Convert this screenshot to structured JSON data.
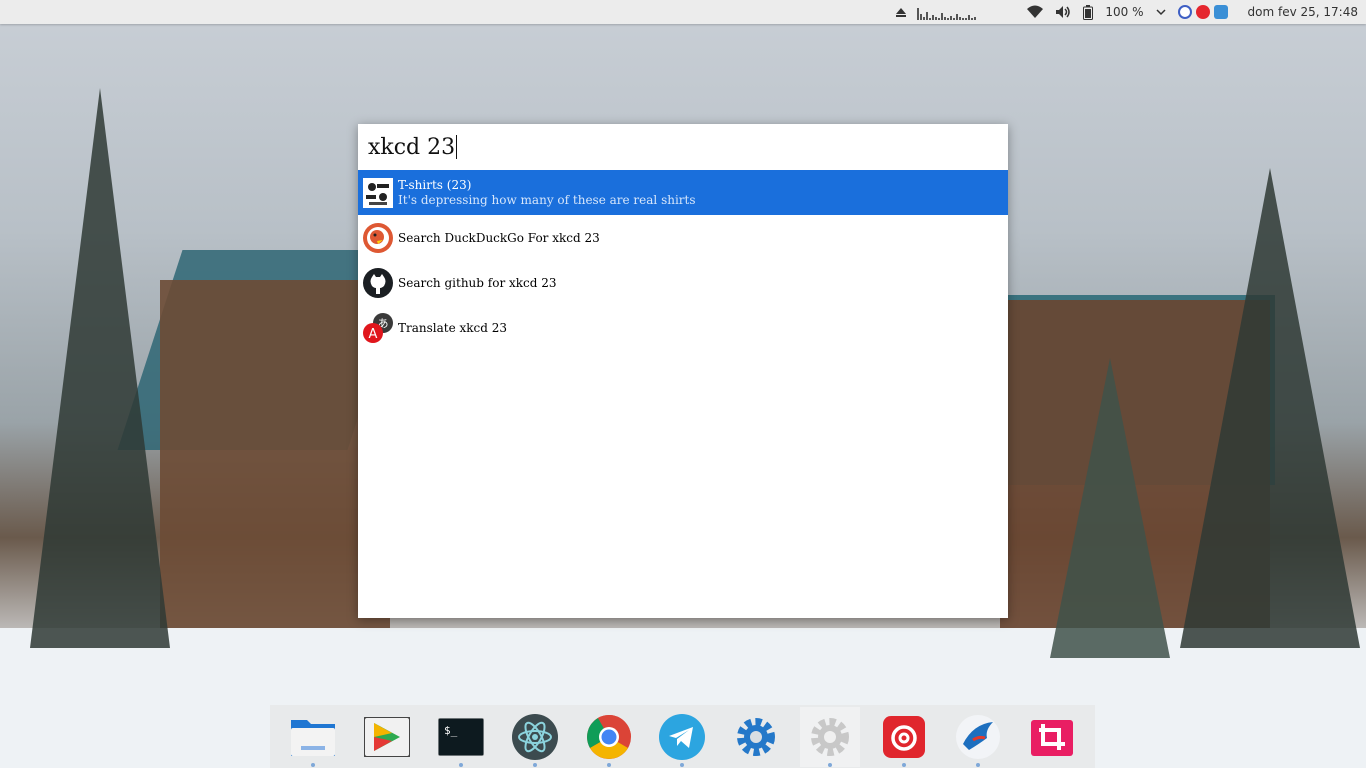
{
  "topbar": {
    "battery_percent": "100 %",
    "datetime": "dom fev 25, 17:48",
    "icons": [
      "eject-icon",
      "network-graph",
      "wifi-icon",
      "volume-icon",
      "battery-icon",
      "chevron-down-icon",
      "copyq-icon",
      "netease-tray-icon",
      "app-tray-icon"
    ]
  },
  "launcher": {
    "query": "xkcd 23",
    "results": [
      {
        "title": "T-shirts (23)",
        "subtitle": "It's depressing how many of these are real shirts",
        "icon": "xkcd-comic-icon",
        "selected": true
      },
      {
        "title": "Search DuckDuckGo For xkcd 23",
        "subtitle": "",
        "icon": "duckduckgo-icon",
        "selected": false
      },
      {
        "title": "Search github for xkcd 23",
        "subtitle": "",
        "icon": "github-icon",
        "selected": false
      },
      {
        "title": "Translate xkcd 23",
        "subtitle": "",
        "icon": "translate-icon",
        "selected": false
      }
    ]
  },
  "dock": {
    "apps": [
      "files-icon",
      "google-play-icon",
      "terminal-icon",
      "atom-icon",
      "chrome-icon",
      "telegram-icon",
      "settings-icon",
      "system-settings-icon",
      "netease-music-icon",
      "bird-app-icon",
      "screenshot-crop-icon"
    ]
  },
  "colors": {
    "selection": "#1a6fdc",
    "topbar": "#ececec"
  }
}
